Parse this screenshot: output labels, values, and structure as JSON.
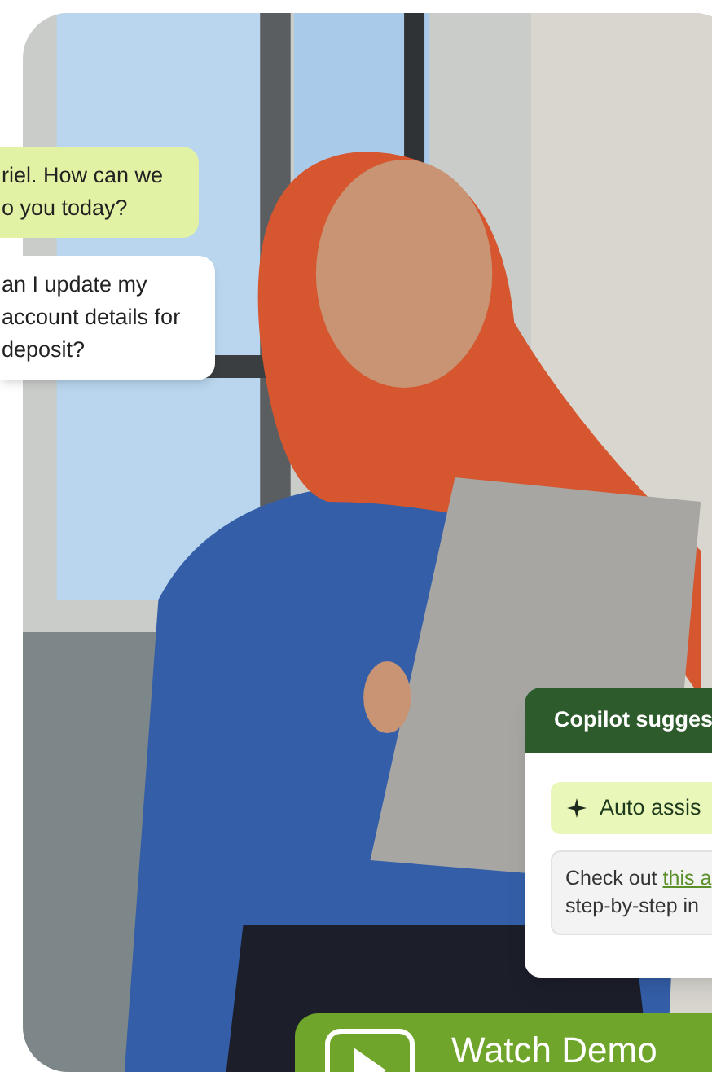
{
  "chat": [
    {
      "kind": "agent",
      "text": "riel. How can we\no you today?"
    },
    {
      "kind": "customer",
      "text": "an I update my\naccount details for\n deposit?"
    }
  ],
  "copilot": {
    "title": "Copilot sugges",
    "action": "Auto assis",
    "message_before": "Check out ",
    "message_link": "this a",
    "message_after": "\nstep-by-step in"
  },
  "cta": {
    "label": "Watch Demo"
  }
}
